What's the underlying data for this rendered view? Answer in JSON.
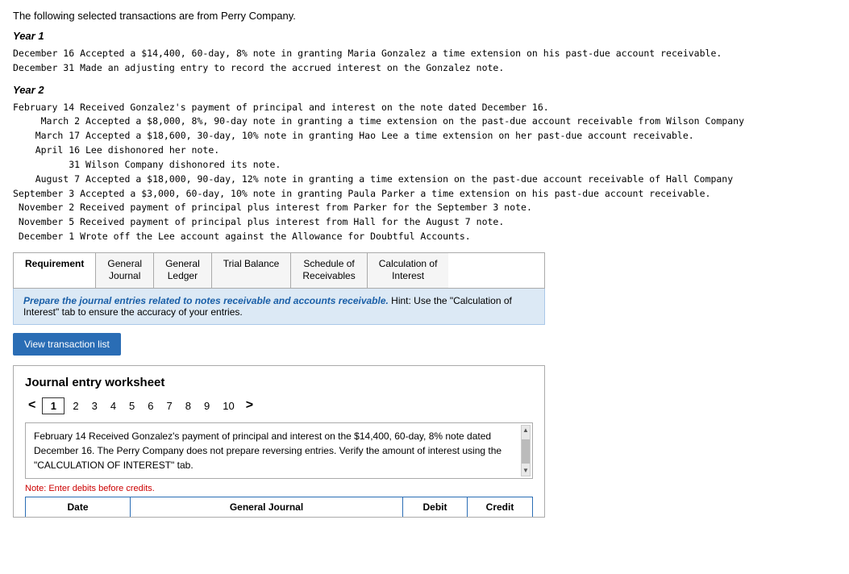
{
  "intro": "The following selected transactions are from Perry Company.",
  "year1": {
    "heading": "Year 1",
    "transactions": "December 16 Accepted a $14,400, 60-day, 8% note in granting Maria Gonzalez a time extension on his past-due account receivable.\nDecember 31 Made an adjusting entry to record the accrued interest on the Gonzalez note."
  },
  "year2": {
    "heading": "Year 2",
    "transactions": "February 14 Received Gonzalez's payment of principal and interest on the note dated December 16.\n     March 2 Accepted a $8,000, 8%, 90-day note in granting a time extension on the past-due account receivable from Wilson Company\n    March 17 Accepted a $18,600, 30-day, 10% note in granting Hao Lee a time extension on her past-due account receivable.\n    April 16 Lee dishonored her note.\n          31 Wilson Company dishonored its note.\n    August 7 Accepted a $18,000, 90-day, 12% note in granting a time extension on the past-due account receivable of Hall Company\nSeptember 3 Accepted a $3,000, 60-day, 10% note in granting Paula Parker a time extension on his past-due account receivable.\n November 2 Received payment of principal plus interest from Parker for the September 3 note.\n November 5 Received payment of principal plus interest from Hall for the August 7 note.\n December 1 Wrote off the Lee account against the Allowance for Doubtful Accounts."
  },
  "tabs": [
    {
      "label": "Requirement",
      "active": true
    },
    {
      "label": "General\nJournal",
      "active": false
    },
    {
      "label": "General\nLedger",
      "active": false
    },
    {
      "label": "Trial Balance",
      "active": false
    },
    {
      "label": "Schedule of\nReceivables",
      "active": false
    },
    {
      "label": "Calculation of\nInterest",
      "active": false
    }
  ],
  "hint": {
    "bold_text": "Prepare the journal entries related to notes receivable and accounts receivable.",
    "rest_text": " Hint:  Use the \"Calculation of Interest\" tab to ensure the accuracy of your entries."
  },
  "view_button": "View transaction list",
  "worksheet": {
    "title": "Journal entry worksheet",
    "pages": [
      "<",
      "1",
      "2",
      "3",
      "4",
      "5",
      "6",
      "7",
      "8",
      "9",
      "10",
      ">"
    ],
    "active_page": "1",
    "description": "February 14 Received Gonzalez's payment of principal and interest on the\n$14,400, 60-day, 8% note dated December 16. The Perry Company does not\nprepare reversing entries. Verify the amount of interest using the\n\"CALCULATION OF INTEREST\" tab.",
    "note": "Note: Enter debits before credits.",
    "columns": [
      "Date",
      "General Journal",
      "Debit",
      "Credit"
    ]
  }
}
